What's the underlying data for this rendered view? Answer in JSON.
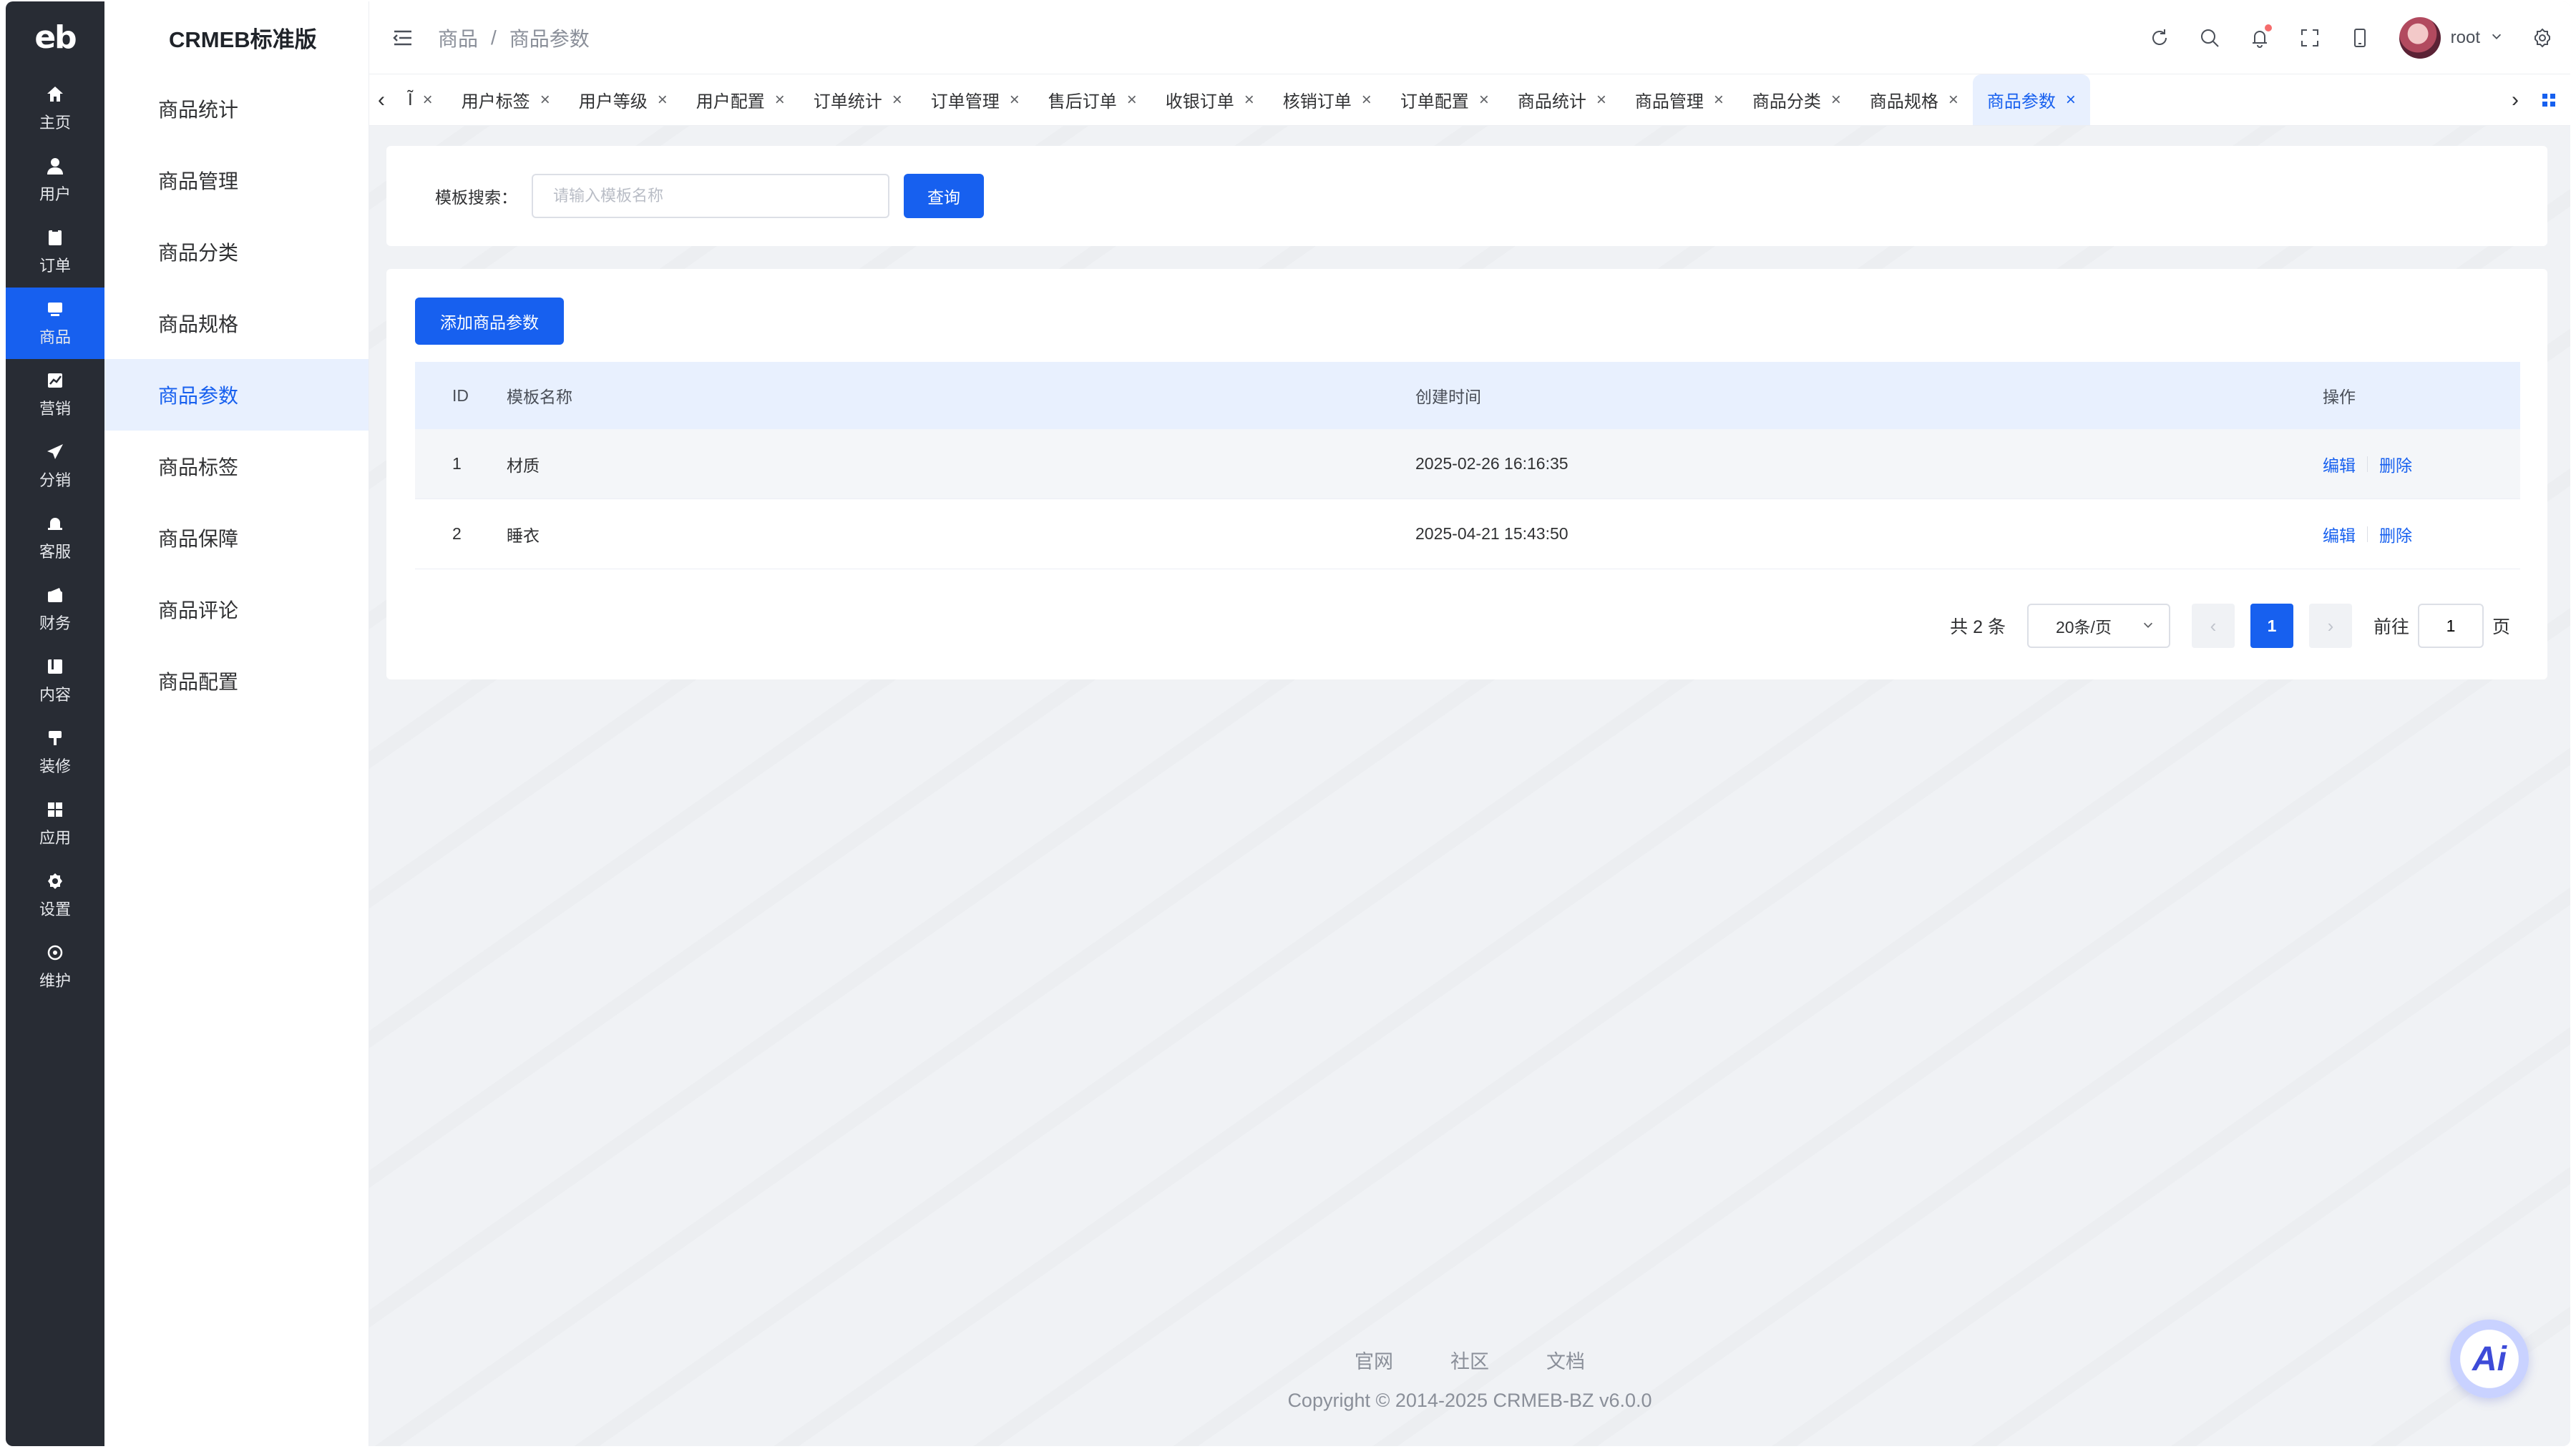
{
  "app": {
    "logo_text": "eb",
    "title": "CRMEB标准版"
  },
  "rail": [
    {
      "label": "主页",
      "icon": "home-icon"
    },
    {
      "label": "用户",
      "icon": "user-icon"
    },
    {
      "label": "订单",
      "icon": "order-icon"
    },
    {
      "label": "商品",
      "icon": "product-icon",
      "active": true
    },
    {
      "label": "营销",
      "icon": "marketing-icon"
    },
    {
      "label": "分销",
      "icon": "distribution-icon"
    },
    {
      "label": "客服",
      "icon": "service-icon"
    },
    {
      "label": "财务",
      "icon": "finance-icon"
    },
    {
      "label": "内容",
      "icon": "content-icon"
    },
    {
      "label": "装修",
      "icon": "decoration-icon"
    },
    {
      "label": "应用",
      "icon": "apps-icon"
    },
    {
      "label": "设置",
      "icon": "settings-icon"
    },
    {
      "label": "维护",
      "icon": "maintenance-icon"
    }
  ],
  "submenu": [
    {
      "label": "商品统计"
    },
    {
      "label": "商品管理"
    },
    {
      "label": "商品分类"
    },
    {
      "label": "商品规格"
    },
    {
      "label": "商品参数",
      "active": true
    },
    {
      "label": "商品标签"
    },
    {
      "label": "商品保障"
    },
    {
      "label": "商品评论"
    },
    {
      "label": "商品配置"
    }
  ],
  "breadcrumb": {
    "parent": "商品",
    "separator": "/",
    "current": "商品参数"
  },
  "user": {
    "name": "root"
  },
  "tabs": {
    "truncated": "Ĩ",
    "items": [
      "用户标签",
      "用户等级",
      "用户配置",
      "订单统计",
      "订单管理",
      "售后订单",
      "收银订单",
      "核销订单",
      "订单配置",
      "商品统计",
      "商品管理",
      "商品分类",
      "商品规格",
      "商品参数"
    ],
    "active": "商品参数",
    "close_glyph": "×"
  },
  "search": {
    "label": "模板搜索：",
    "placeholder": "请输入模板名称",
    "value": "",
    "button": "查询"
  },
  "table": {
    "add_button": "添加商品参数",
    "headers": {
      "id": "ID",
      "name": "模板名称",
      "created": "创建时间",
      "actions": "操作"
    },
    "rows": [
      {
        "id": "1",
        "name": "材质",
        "created": "2025-02-26 16:16:35",
        "edit": "编辑",
        "delete": "删除"
      },
      {
        "id": "2",
        "name": "睡衣",
        "created": "2025-04-21 15:43:50",
        "edit": "编辑",
        "delete": "删除"
      }
    ]
  },
  "pagination": {
    "total": "共 2 条",
    "page_size": "20条/页",
    "current_page": "1",
    "goto_label": "前往",
    "goto_value": "1",
    "page_suffix": "页"
  },
  "footer": {
    "links": [
      "官网",
      "社区",
      "文档"
    ],
    "copyright": "Copyright © 2014-2025 CRMEB-BZ v6.0.0"
  },
  "ai_button": {
    "label": "Ai"
  },
  "colors": {
    "primary": "#1760ef",
    "rail_bg": "#282c34",
    "page_bg": "#f0f2f5"
  }
}
